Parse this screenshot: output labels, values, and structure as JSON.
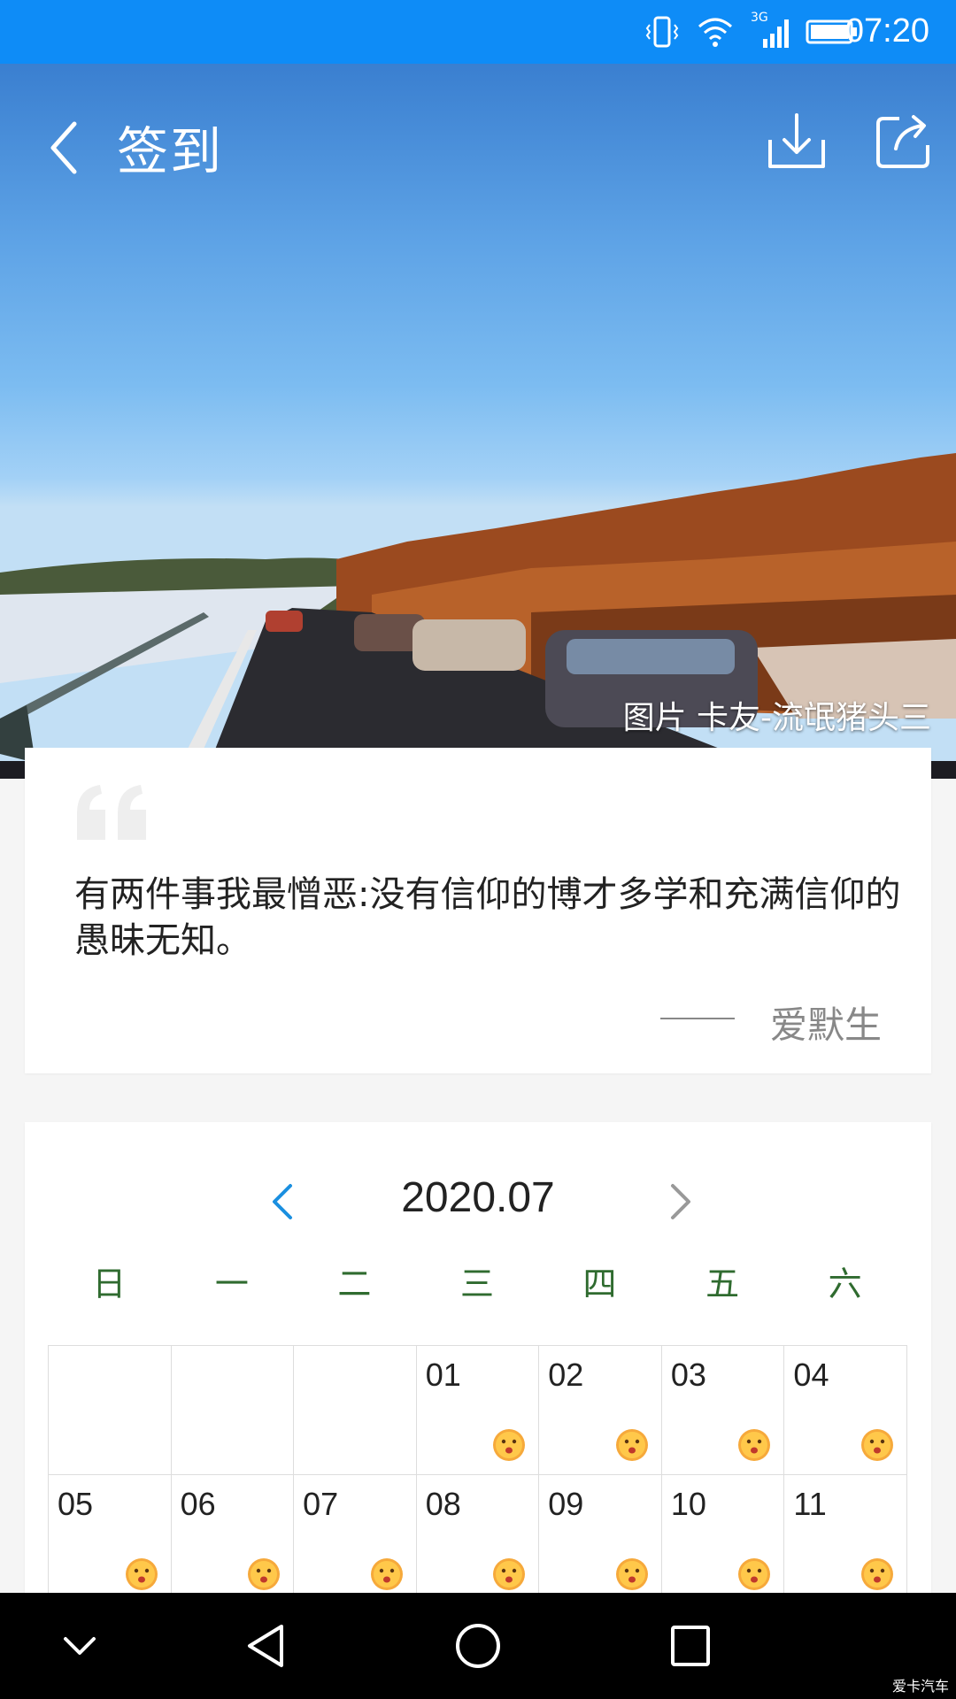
{
  "status_bar": {
    "time": "07:20",
    "network": "3G"
  },
  "header": {
    "title": "签到",
    "photo_credit": "图片 卡友-流氓猪头三"
  },
  "quote": {
    "text": "有两件事我最憎恶:没有信仰的博才多学和充满信仰的愚昧无知。",
    "author": "爱默生"
  },
  "calendar": {
    "month": "2020.07",
    "weekdays": [
      "日",
      "一",
      "二",
      "三",
      "四",
      "五",
      "六"
    ],
    "days": [
      {
        "num": "",
        "emoji": false
      },
      {
        "num": "",
        "emoji": false
      },
      {
        "num": "",
        "emoji": false
      },
      {
        "num": "01",
        "emoji": true
      },
      {
        "num": "02",
        "emoji": true
      },
      {
        "num": "03",
        "emoji": true
      },
      {
        "num": "04",
        "emoji": true
      },
      {
        "num": "05",
        "emoji": true
      },
      {
        "num": "06",
        "emoji": true
      },
      {
        "num": "07",
        "emoji": true
      },
      {
        "num": "08",
        "emoji": true
      },
      {
        "num": "09",
        "emoji": true
      },
      {
        "num": "10",
        "emoji": true
      },
      {
        "num": "11",
        "emoji": true
      }
    ]
  },
  "watermark": "爱卡汽车",
  "icons": {
    "back": "back-arrow-icon",
    "download": "download-icon",
    "share": "share-icon",
    "prev": "chevron-left-icon",
    "next": "chevron-right-icon"
  },
  "colors": {
    "status_bar": "#0e8cf7",
    "accent": "#1a8fe0",
    "weekday": "#2f6b2f"
  }
}
